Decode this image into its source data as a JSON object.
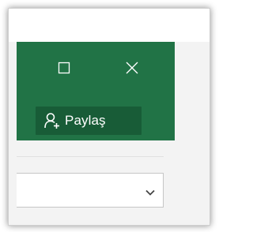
{
  "window": {
    "accent_color": "#217346",
    "share_button_bg": "#185c37",
    "controls": {
      "maximize_icon": "maximize-icon",
      "close_icon": "close-icon"
    }
  },
  "ribbon": {
    "share_label": "Paylaş",
    "share_icon": "add-person-icon"
  },
  "toolbar": {
    "combo_value": "",
    "combo_icon": "chevron-down-icon"
  }
}
